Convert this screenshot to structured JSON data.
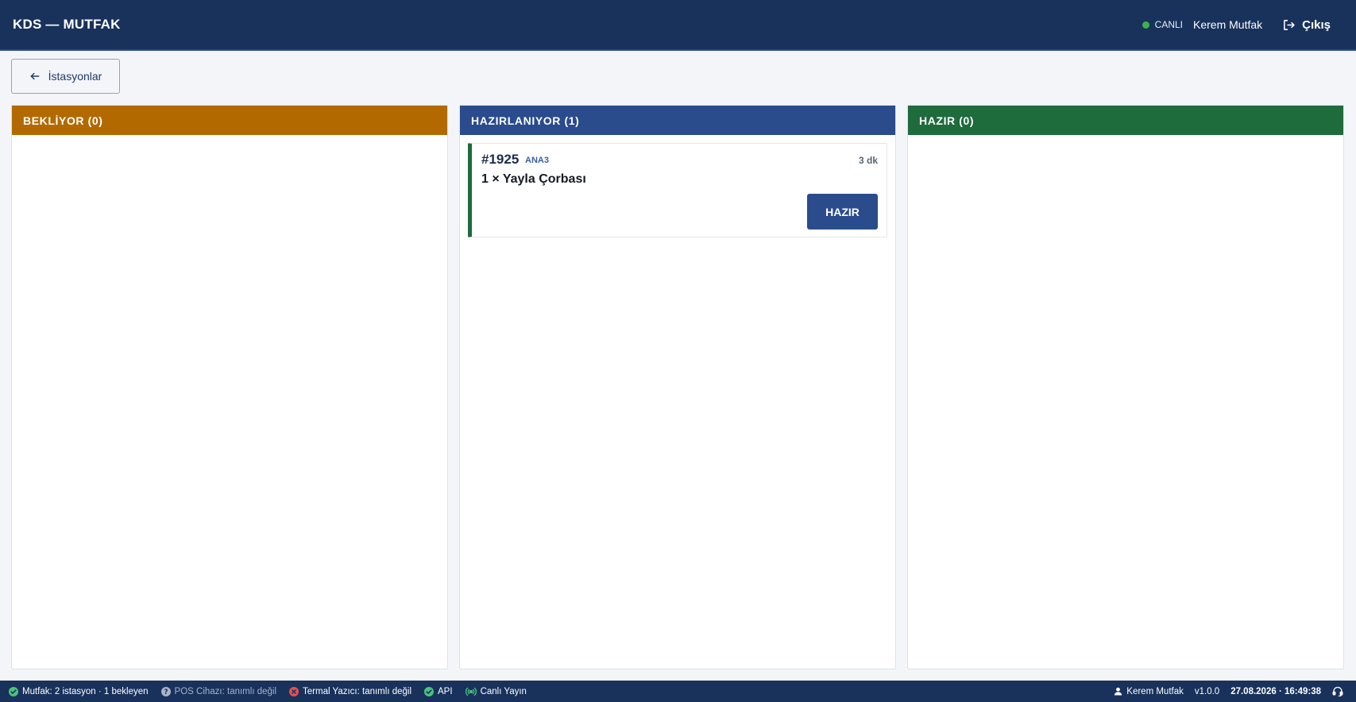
{
  "header": {
    "title": "KDS — MUTFAK",
    "live_label": "CANLI",
    "user": "Kerem Mutfak",
    "logout_label": "Çıkış"
  },
  "back_button": {
    "label": "İstasyonlar"
  },
  "columns": [
    {
      "title": "BEKLİYOR (0)",
      "color": "#b26a00"
    },
    {
      "title": "HAZIRLANIYOR (1)",
      "color": "#2a4b8c",
      "orders": [
        {
          "number": "#1925",
          "station": "ANA3",
          "elapsed": "3 dk",
          "item": "1 × Yayla Çorbası",
          "action_label": "HAZIR"
        }
      ]
    },
    {
      "title": "HAZIR (0)",
      "color": "#1e6b3c"
    }
  ],
  "statusbar": {
    "kitchen": "Mutfak: 2 istasyon · 1 bekleyen",
    "pos": "POS Cihazı: tanımlı değil",
    "printer": "Termal Yazıcı: tanımlı değil",
    "api": "API",
    "live_stream": "Canlı Yayın",
    "user": "Kerem Mutfak",
    "version": "v1.0.0",
    "datetime": "27.08.2026 · 16:49:38"
  },
  "colors": {
    "header_bg": "#18325c",
    "ok_green": "#4cc27a",
    "error_red": "#e0524f",
    "live_dot": "#3cb34a"
  }
}
